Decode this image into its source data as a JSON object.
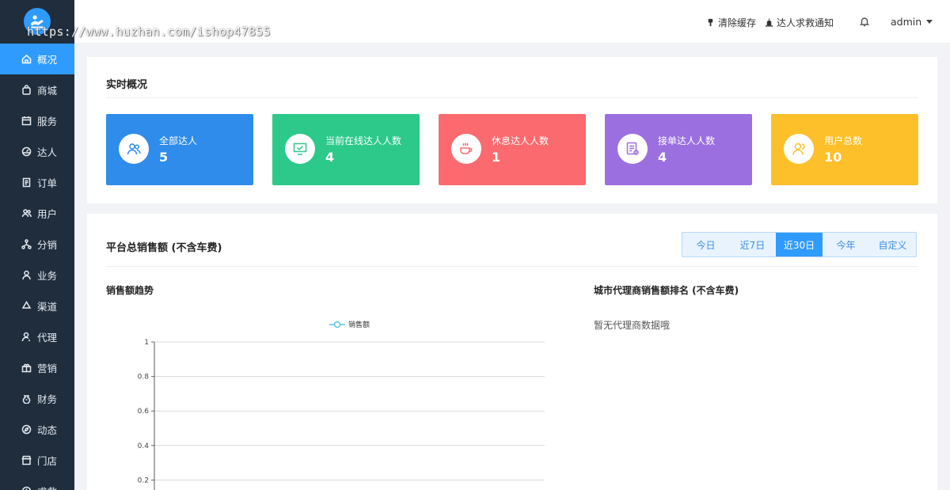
{
  "watermark": "https://www.huzhan.com/ishop47855",
  "sidebar": {
    "items": [
      {
        "label": "概况",
        "icon": "home-icon",
        "active": true
      },
      {
        "label": "商城",
        "icon": "bag-icon"
      },
      {
        "label": "服务",
        "icon": "calendar-icon"
      },
      {
        "label": "达人",
        "icon": "gauge-icon"
      },
      {
        "label": "订单",
        "icon": "document-icon"
      },
      {
        "label": "用户",
        "icon": "users-icon"
      },
      {
        "label": "分销",
        "icon": "network-icon"
      },
      {
        "label": "业务",
        "icon": "user-icon"
      },
      {
        "label": "渠道",
        "icon": "recycle-icon"
      },
      {
        "label": "代理",
        "icon": "agent-icon"
      },
      {
        "label": "营销",
        "icon": "gift-icon"
      },
      {
        "label": "财务",
        "icon": "moneybag-icon"
      },
      {
        "label": "动态",
        "icon": "compass-icon"
      },
      {
        "label": "门店",
        "icon": "store-icon"
      },
      {
        "label": "求救",
        "icon": "sos-icon"
      }
    ]
  },
  "header": {
    "clear_cache": "清除缓存",
    "rescue_notice": "达人求救通知",
    "user": "admin"
  },
  "overview": {
    "title": "实时概况",
    "cards": [
      {
        "label": "全部达人",
        "value": "5",
        "color": "#2f8ceb",
        "icon": "users-icon"
      },
      {
        "label": "当前在线达人人数",
        "value": "4",
        "color": "#2cc98b",
        "icon": "monitor-icon"
      },
      {
        "label": "休息达人人数",
        "value": "1",
        "color": "#fb6a6e",
        "icon": "coffee-icon"
      },
      {
        "label": "接单达人人数",
        "value": "4",
        "color": "#9b6fdf",
        "icon": "order-icon"
      },
      {
        "label": "用户总数",
        "value": "10",
        "color": "#fdc02a",
        "icon": "user-group-icon"
      }
    ]
  },
  "sales": {
    "title": "平台总销售额 (不含车费)",
    "tabs": [
      "今日",
      "近7日",
      "近30日",
      "今年",
      "自定义"
    ],
    "active_tab": "近30日",
    "trend_title": "销售额趋势",
    "ranking_title": "城市代理商销售额排名 (不含车费)",
    "ranking_empty": "暂无代理商数据哦"
  },
  "chart_data": {
    "type": "line",
    "series": [
      {
        "name": "销售额",
        "values": []
      }
    ],
    "y_ticks": [
      "1",
      "0.8",
      "0.6",
      "0.4",
      "0.2"
    ],
    "ylim": [
      0,
      1
    ],
    "grid": true,
    "legend": "top-center",
    "line_color": "#5ec4e8"
  }
}
